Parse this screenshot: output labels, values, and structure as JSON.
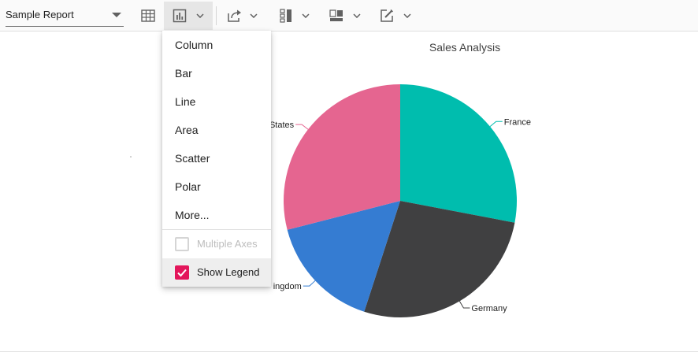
{
  "toolbar": {
    "report_select": {
      "value": "Sample Report"
    },
    "buttons": [
      {
        "name": "grid-view",
        "icon": "table-icon"
      },
      {
        "name": "chart-view",
        "icon": "bar-chart-icon",
        "active": true
      },
      {
        "name": "export",
        "icon": "export-icon"
      },
      {
        "name": "sub-totals",
        "icon": "subtotals-icon"
      },
      {
        "name": "grand-totals",
        "icon": "grand-totals-icon"
      },
      {
        "name": "formatting",
        "icon": "edit-format-icon"
      }
    ]
  },
  "chart_menu": {
    "items": [
      "Column",
      "Bar",
      "Line",
      "Area",
      "Scatter",
      "Polar",
      "More..."
    ],
    "multiple_axes": {
      "label": "Multiple Axes",
      "checked": false,
      "disabled": true
    },
    "show_legend": {
      "label": "Show Legend",
      "checked": true
    }
  },
  "chart_data": {
    "type": "pie",
    "title": "Sales Analysis",
    "labels": [
      "France",
      "Germany",
      "United Kingdom",
      "United States"
    ],
    "visible_labels": [
      "France",
      "Germany",
      "ingdom",
      "States"
    ],
    "values": [
      28,
      27,
      16,
      29
    ],
    "colors": [
      "#00bdae",
      "#404041",
      "#357cd2",
      "#e56590"
    ]
  },
  "colors": {
    "accent": "#e3165b"
  }
}
